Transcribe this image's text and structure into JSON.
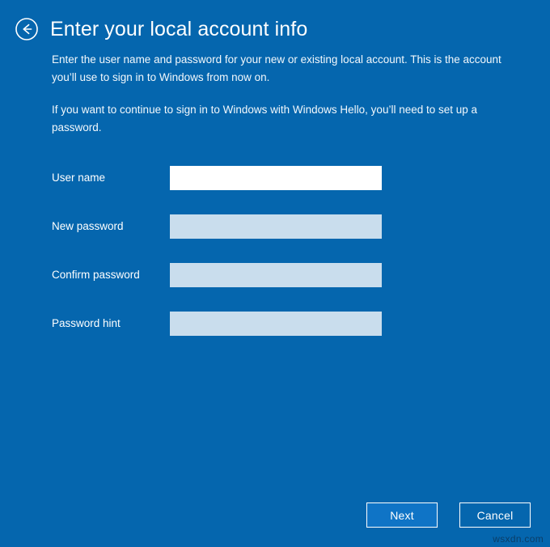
{
  "window": {
    "background_color": "#0566ae",
    "text_color": "#ffffff"
  },
  "header": {
    "back_icon": "back-arrow-circle-icon",
    "title": "Enter your local account info"
  },
  "body_copy": {
    "paragraphs": [
      "Enter the user name and password for your new or existing local account. This is the account you’ll use to sign in to Windows from now on.",
      "If you want to continue to sign in to Windows with Windows Hello, you’ll need to set up a password."
    ]
  },
  "form": {
    "fields": [
      {
        "label": "User name",
        "value": "",
        "placeholder": "",
        "type": "text",
        "state": "active",
        "fill_color": "#ffffff"
      },
      {
        "label": "New password",
        "value": "",
        "placeholder": "",
        "type": "password",
        "state": "inactive",
        "fill_color": "#c9dded"
      },
      {
        "label": "Confirm password",
        "value": "",
        "placeholder": "",
        "type": "password",
        "state": "inactive",
        "fill_color": "#c9dded"
      },
      {
        "label": "Password hint",
        "value": "",
        "placeholder": "",
        "type": "text",
        "state": "inactive",
        "fill_color": "#c9dded"
      }
    ]
  },
  "footer": {
    "primary_button": {
      "label": "Next",
      "fill_color": "#0f74c6",
      "border_color": "#ffffff"
    },
    "secondary_button": {
      "label": "Cancel",
      "fill_color": "transparent",
      "border_color": "#ffffff"
    }
  },
  "watermark": {
    "text": "wsxdn.com",
    "color": "#0b3e68"
  }
}
